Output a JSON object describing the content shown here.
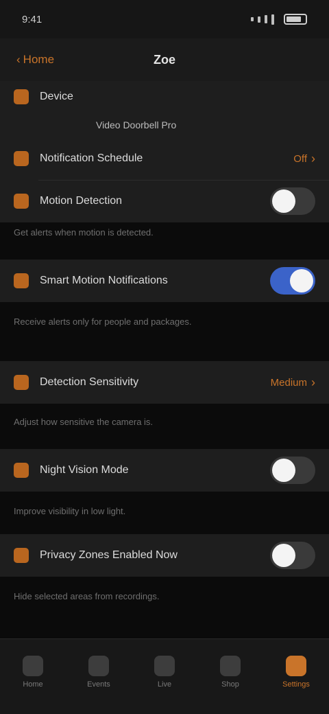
{
  "status_bar": {
    "time": "9:41"
  },
  "header": {
    "back_label": "Home",
    "title": "Zoe"
  },
  "device_section": {
    "name_label": "Device",
    "info_line": "Video Doorbell Pro",
    "rows": [
      {
        "label": "Notification Schedule",
        "value": "Off"
      },
      {
        "label": "Motion Detection",
        "toggle": false
      }
    ]
  },
  "motion_footnote": "Get alerts when motion is detected.",
  "smart_alerts": {
    "label": "Smart Motion Notifications",
    "toggle": true
  },
  "smart_footnote": "Receive alerts only for people and packages.",
  "sensitivity": {
    "label": "Detection Sensitivity",
    "value": "Medium"
  },
  "sensitivity_footnote": "Adjust how sensitive the camera is.",
  "night_vision": {
    "label": "Night Vision Mode",
    "toggle": false
  },
  "night_footnote": "Improve visibility in low light.",
  "privacy": {
    "label": "Privacy Zones Enabled Now",
    "toggle": false
  },
  "privacy_footnote": "Hide selected areas from recordings.",
  "tabs": [
    {
      "label": "Home",
      "icon": "home-icon"
    },
    {
      "label": "Events",
      "icon": "events-icon"
    },
    {
      "label": "Live",
      "icon": "live-icon"
    },
    {
      "label": "Shop",
      "icon": "shop-icon"
    },
    {
      "label": "Settings",
      "icon": "settings-icon"
    }
  ],
  "colors": {
    "accent": "#c9742a",
    "toggle_on": "#3b63c9",
    "background": "#0b0b0b",
    "surface": "#1e1e1e"
  }
}
